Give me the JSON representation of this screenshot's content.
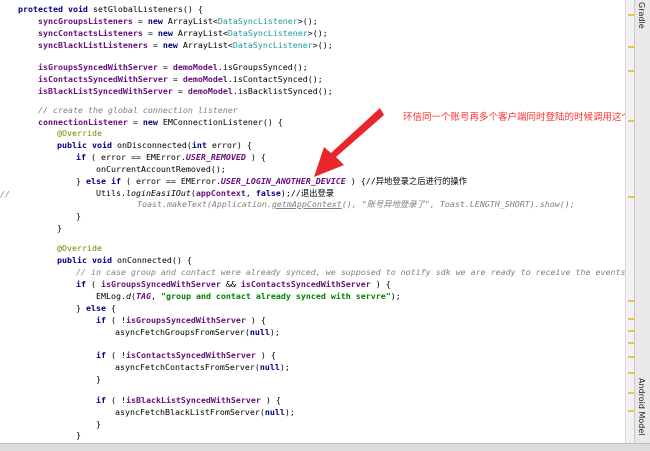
{
  "code": {
    "l1": {
      "a": "protected void",
      "b": " setGlobalListeners() {"
    },
    "l2": {
      "a": "syncGroupsListeners",
      "b": " = ",
      "c": "new",
      "d": " ArrayList<",
      "e": "DataSyncListener",
      "f": ">();"
    },
    "l3": {
      "a": "syncContactsListeners",
      "b": " = ",
      "c": "new",
      "d": " ArrayList<",
      "e": "DataSyncListener",
      "f": ">();"
    },
    "l4": {
      "a": "syncBlackListListeners",
      "b": " = ",
      "c": "new",
      "d": " ArrayList<",
      "e": "DataSyncListener",
      "f": ">();"
    },
    "l5": {
      "a": "isGroupsSyncedWithServer",
      "b": " = ",
      "c": "demoModel",
      "d": ".isGroupsSynced();"
    },
    "l6": {
      "a": "isContactsSyncedWithServer",
      "b": " = ",
      "c": "demoModel",
      "d": ".isContactSynced();"
    },
    "l7": {
      "a": "isBlackListSyncedWithServer",
      "b": " = ",
      "c": "demoModel",
      "d": ".isBacklistSynced();"
    },
    "l8": {
      "a": "// create the global connection listener"
    },
    "l9": {
      "a": "connectionListener",
      "b": " = ",
      "c": "new",
      "d": " EMConnectionListener() {"
    },
    "l10": {
      "a": "@Override"
    },
    "l11": {
      "a": "public void",
      "b": " onDisconnected(",
      "c": "int",
      "d": " error) {"
    },
    "l12": {
      "a": "if",
      "b": " ( error == EMError.",
      "c": "USER_REMOVED",
      "d": " ) {"
    },
    "l13": {
      "a": "onCurrentAccountRemoved();"
    },
    "l14": {
      "a": "} ",
      "b": "else if",
      "c": " ( error == EMError.",
      "d": "USER_LOGIN_ANOTHER_DEVICE",
      "e": " ) {",
      "f": "//异地登录之后进行的操作"
    },
    "l15": {
      "a": "Utils.",
      "b": "loginEasiIOut",
      "c": "(",
      "d": "appContext",
      "e": ", ",
      "f": "false",
      "g": ");",
      "h": "//退出登录"
    },
    "l16": {
      "a": "Toast.makeText(Application.",
      "b": "getmAppContext",
      "c": "(), \"账号异地登录了\", Toast.LENGTH_SHORT).show();"
    },
    "l17": {
      "a": "}"
    },
    "l18": {
      "a": "}"
    },
    "l19": {
      "a": "@Override"
    },
    "l20": {
      "a": "public void",
      "b": " onConnected() {"
    },
    "l21": {
      "a": "// in case group and contact were already synced, we supposed to notify sdk we are ready to receive the events"
    },
    "l22": {
      "a": "if",
      "b": " ( ",
      "c": "isGroupsSyncedWithServer",
      "d": " && ",
      "e": "isContactsSyncedWithServer",
      "f": " ) {"
    },
    "l23": {
      "a": "EMLog.",
      "b": "d",
      "c": "(",
      "d": "TAG",
      "e": ", ",
      "f": "\"group and contact already synced with servre\"",
      "g": ");"
    },
    "l24": {
      "a": "} ",
      "b": "else",
      "c": " {"
    },
    "l25": {
      "a": "if",
      "b": " ( !",
      "c": "isGroupsSyncedWithServer",
      "d": " ) {"
    },
    "l26": {
      "a": "asyncFetchGroupsFromServer(",
      "b": "null",
      "c": ");"
    },
    "l27": {
      "a": "if",
      "b": " ( !",
      "c": "isContactsSyncedWithServer",
      "d": " ) {"
    },
    "l28": {
      "a": "asyncFetchContactsFromServer(",
      "b": "null",
      "c": ");"
    },
    "l29": {
      "a": "}"
    },
    "l30": {
      "a": "if",
      "b": " ( !",
      "c": "isBlackListSyncedWithServer",
      "d": " ) {"
    },
    "l31": {
      "a": "asyncFetchBlackListFromServer(",
      "b": "null",
      "c": ");"
    },
    "l32": {
      "a": "}"
    },
    "l33": {
      "a": "}"
    },
    "l34": {
      "a": "}"
    },
    "l35": {
      "a": "};"
    }
  },
  "gutter_comment": "//",
  "annotation_text": "环信同一个账号再多个客户端同时登陆的时候调用这个方",
  "side_tabs": {
    "top": "Gradle",
    "bottom": "Android Model"
  },
  "colors": {
    "annotation": "#ff3030",
    "arrow": "#e8262b",
    "keyword": "#000080",
    "field": "#660e7a",
    "string": "#008000",
    "comment": "#808080"
  },
  "icons": {
    "arrow": "red-arrow-pointer"
  }
}
